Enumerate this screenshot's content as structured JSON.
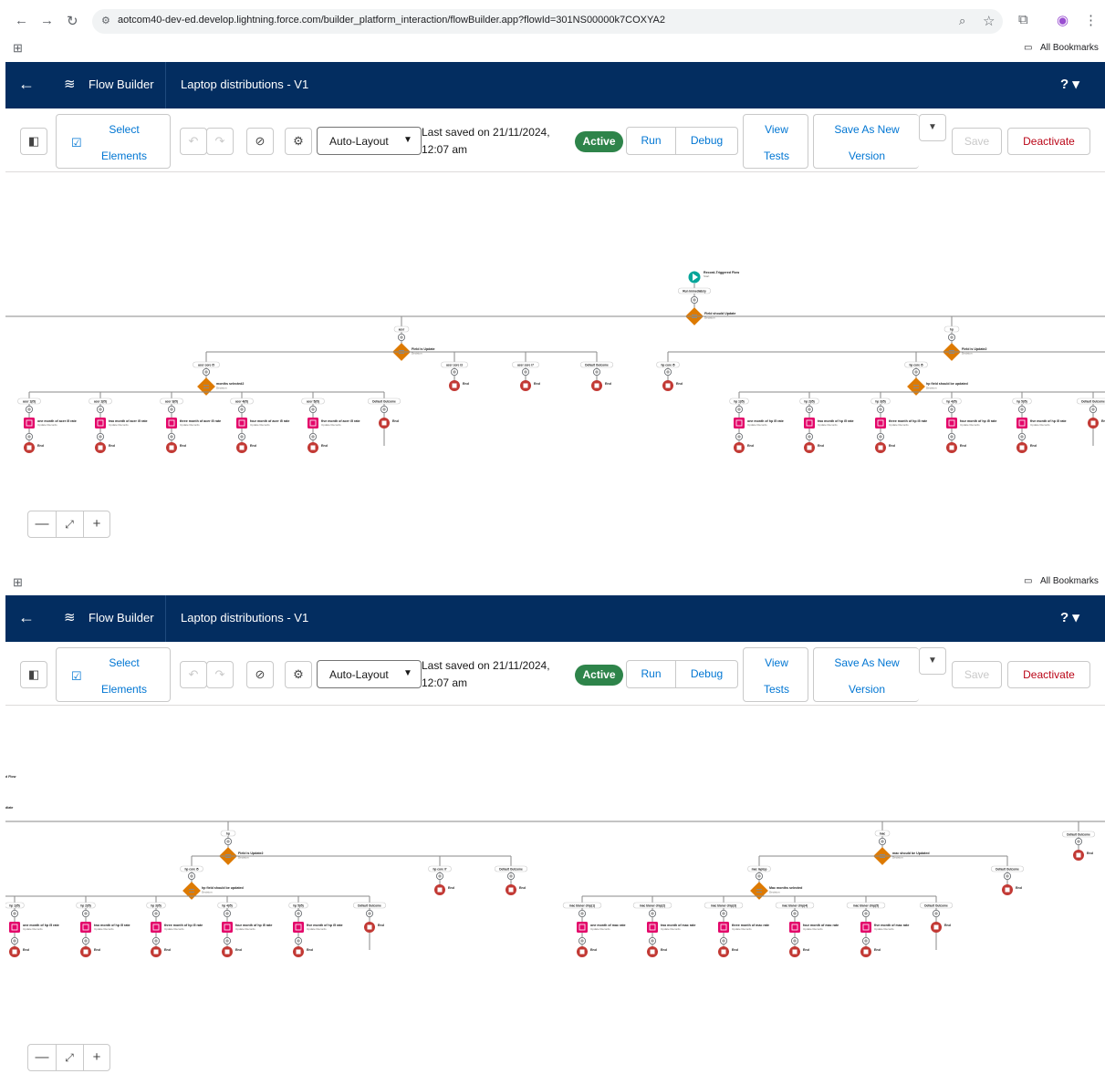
{
  "browser": {
    "url": "aotcom40-dev-ed.develop.lightning.force.com/builder_platform_interaction/flowBuilder.app?flowId=301NS00000k7COXYA2",
    "bookmarks_label": "All Bookmarks"
  },
  "header": {
    "app_name": "Flow Builder",
    "flow_title": "Laptop distributions - V1",
    "help_label": "?"
  },
  "toolbar": {
    "select_line1": "Select",
    "select_line2": "Elements",
    "layout_value": "Auto-Layout",
    "saved_line1": "Last saved on 21/11/2024,",
    "saved_line2": "12:07 am",
    "status": "Active",
    "run": "Run",
    "debug": "Debug",
    "view_line1": "View",
    "view_line2": "Tests",
    "saveas_line1": "Save As New",
    "saveas_line2": "Version",
    "save": "Save",
    "deactivate": "Deactivate"
  },
  "colors": {
    "header_bg": "#032d60",
    "active": "#2e844a",
    "decision": "#dd7a01",
    "update": "#e3066a",
    "end": "#c23934",
    "start": "#06a59a"
  },
  "flow1": {
    "start_label": "Record-Triggered Flow",
    "start_sub": "Start",
    "run_label": "Run Immediately",
    "d1_label": "Field should Update",
    "decision_sub": "Decision",
    "left_branch": "acer",
    "left_decision": "Field is Update",
    "right_branch": "hp",
    "right_decision": "Field is Update2",
    "acer_outcomes": [
      "acer core i5",
      "acer core i3",
      "acer core i7",
      "Default Outcome"
    ],
    "acer_months_decision": "months selected2",
    "acer_month_branches": [
      "acer 1(i5)",
      "acer 2(i5)",
      "acer 3(i5)",
      "acer 4(i5)",
      "acer 5(i5)",
      "Default Outcome"
    ],
    "acer_updates": [
      "one month of acer i5 rate",
      "two month of acer i5 rate",
      "three month of acer i5 rate",
      "four month of acer i5 rate",
      "five month of acer i5 rate"
    ],
    "update_sub": "Update Records",
    "end_label": "End",
    "hp_outcomes": [
      "hp core i5",
      "hp core i5"
    ],
    "hp_months_decision": "hp field should be updated",
    "hp_month_branches": [
      "hp 1(i5)",
      "hp 2(i5)",
      "hp 3(i5)",
      "hp 4(i5)",
      "hp 5(i5)",
      "Default Outcome"
    ],
    "hp_updates": [
      "one month of hp i5 rate",
      "two month of hp i5 rate",
      "three month of hp i5 rate",
      "four month of hp i5 rate",
      "five month of hp i5 rate"
    ]
  },
  "flow2": {
    "start_cut": "d Flow",
    "run_cut": "diate",
    "hp_branch": "hp",
    "hp_decision": "Field is Update2",
    "decision_sub": "Decision",
    "hp_outcomes": [
      "hp core i5",
      "hp core i7",
      "Default Outcome"
    ],
    "hp_months_decision": "hp field should be updated",
    "hp_month_branches": [
      "hp 1(i5)",
      "hp 2(i5)",
      "hp 3(i5)",
      "hp 4(i5)",
      "hp 5(i5)",
      "Default Outcome"
    ],
    "hp_updates": [
      "one month of hp i5 rate",
      "two month of hp i5 rate",
      "three month of hp i5 rate",
      "four month of hp i5 rate",
      "five month of hp i5 rate"
    ],
    "mac_branch": "mac",
    "mac_decision": "mac should be Updated",
    "mac_outcomes": [
      "mac laptop",
      "Default Outcome"
    ],
    "mac_months_decision": "Mac months selected",
    "mac_month_branches": [
      "mac blaner chip(1)",
      "mac blaner chip(2)",
      "mac blaner chip(3)",
      "mac blaner chip(4)",
      "mac blaner chip(5)",
      "Default Outcome"
    ],
    "mac_updates": [
      "one month of mac rate",
      "two month of mac rate",
      "three month of mac rate",
      "four month of mac rate",
      "five month of mac rate"
    ],
    "top_default": "Default Outcome",
    "update_sub": "Update Records",
    "end_label": "End"
  },
  "zoom": {
    "minus": "—",
    "fit": "⤢",
    "plus": "+"
  }
}
